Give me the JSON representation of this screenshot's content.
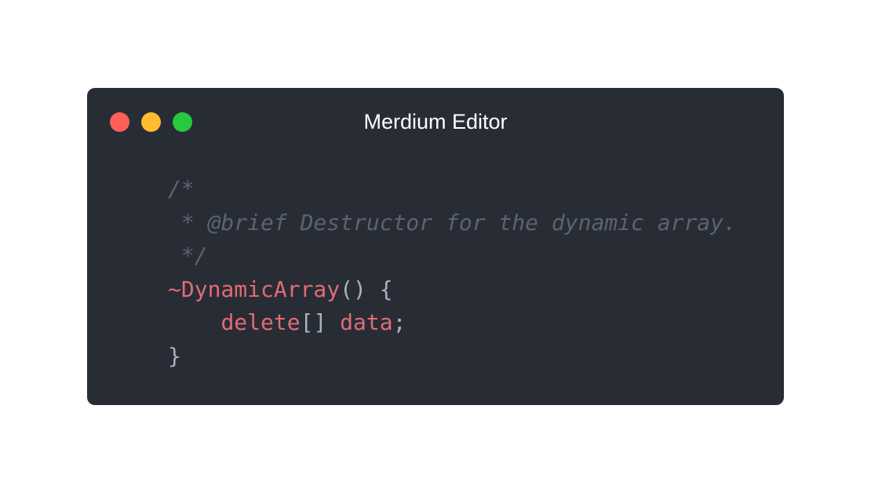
{
  "window": {
    "title": "Merdium Editor",
    "controls": {
      "close_color": "#ff5f57",
      "minimize_color": "#febc2e",
      "maximize_color": "#28c840"
    }
  },
  "code": {
    "comment_open": "/*",
    "comment_body": " * @brief Destructor for the dynamic array.",
    "comment_close": " */",
    "destructor_name": "~DynamicArray",
    "destructor_rest": "() {",
    "body_indent": "    ",
    "delete_keyword": "delete",
    "brackets": "[] ",
    "data_ident": "data",
    "semicolon": ";",
    "closing_brace": "}"
  },
  "colors": {
    "background": "#282c35",
    "comment": "#5c6370",
    "keyword": "#e06c75",
    "text": "#abb2bf"
  }
}
